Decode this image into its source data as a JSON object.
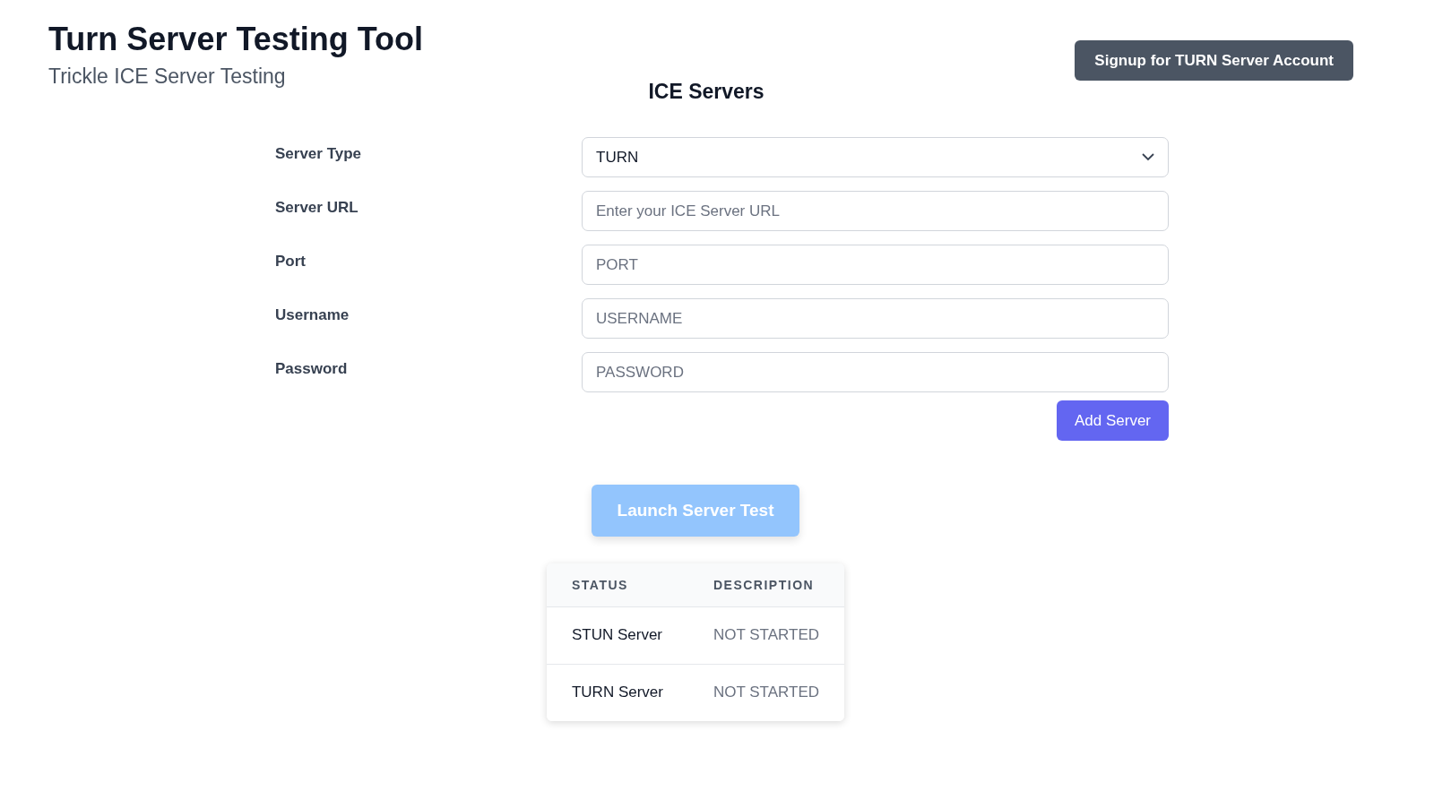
{
  "header": {
    "title": "Turn Server Testing Tool",
    "subtitle": "Trickle ICE Server Testing",
    "signup_button": "Signup for TURN Server Account"
  },
  "section_title": "ICE Servers",
  "form": {
    "fields": [
      {
        "kind": "select",
        "label": "Server Type",
        "value": "TURN"
      },
      {
        "kind": "input",
        "label": "Server URL",
        "placeholder": "Enter your ICE Server URL"
      },
      {
        "kind": "input",
        "label": "Port",
        "placeholder": "PORT"
      },
      {
        "kind": "input",
        "label": "Username",
        "placeholder": "USERNAME"
      },
      {
        "kind": "input",
        "label": "Password",
        "placeholder": "PASSWORD"
      }
    ],
    "add_button": "Add Server"
  },
  "launch_button": {
    "label": "Launch Server Test",
    "disabled": true
  },
  "table": {
    "columns": [
      "STATUS",
      "DESCRIPTION"
    ],
    "rows": [
      {
        "cells": [
          "STUN Server",
          "NOT STARTED"
        ]
      },
      {
        "cells": [
          "TURN Server",
          "NOT STARTED"
        ]
      }
    ]
  }
}
